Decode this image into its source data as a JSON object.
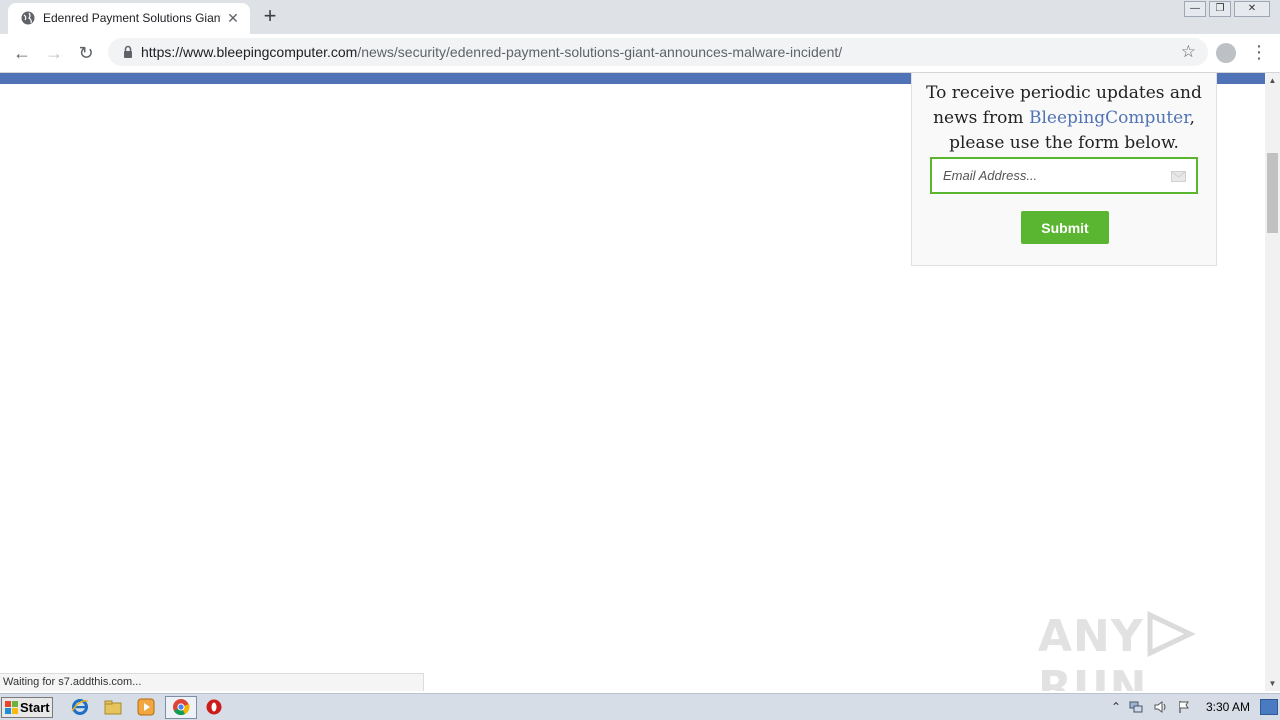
{
  "browser": {
    "tab_title": "Edenred Payment Solutions Giant Announces Malware Incident",
    "tab_close": "✕",
    "new_tab": "+",
    "url_host": "https://www.bleepingcomputer.com",
    "url_path": "/news/security/edenred-payment-solutions-giant-announces-malware-incident/",
    "back": "←",
    "forward": "→",
    "reload": "↻",
    "star": "☆",
    "menu": "⋮",
    "window_minimize": "—",
    "window_restore": "❐",
    "window_close": "✕"
  },
  "signup": {
    "line1": "To receive periodic updates and",
    "line2_prefix": "news from ",
    "brand": "BleepingComputer",
    "line2_suffix": ",",
    "line3": "please use the form below.",
    "email_placeholder": "Email Address...",
    "submit_label": "Submit"
  },
  "watermark": {
    "left": "ANY",
    "right": "RUN"
  },
  "status": {
    "text": "Waiting for s7.addthis.com..."
  },
  "taskbar": {
    "start_label": "Start",
    "clock": "3:30 AM",
    "tray_chevron": "⌃"
  },
  "colors": {
    "nav_blue": "#4f73b6",
    "submit_green": "#5ab530",
    "brand_link": "#4f73b6"
  }
}
